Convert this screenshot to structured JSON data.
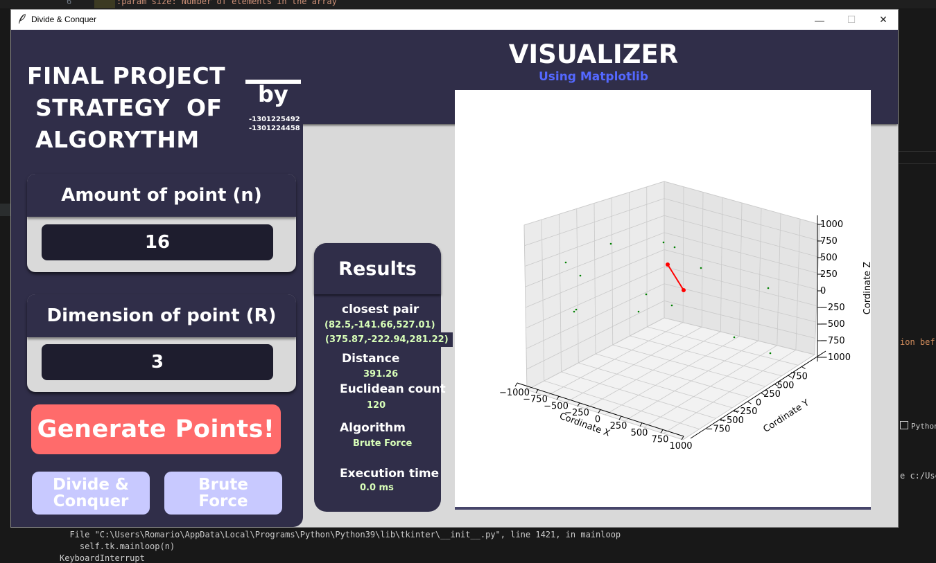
{
  "background": {
    "line_number": "6",
    "code_line": ":param size: Number of elements in the array",
    "right_texts": [
      "ion bef",
      "Python",
      "e c:/User"
    ],
    "terminal_lines": [
      "  File \"C:\\Users\\Romario\\AppData\\Local\\Programs\\Python\\Python39\\lib\\tkinter\\__init__.py\", line 1421, in mainloop",
      "    self.tk.mainloop(n)",
      "KeyboardInterrupt"
    ]
  },
  "window": {
    "title": "Divide & Conquer",
    "minimize": "—",
    "maximize": "☐",
    "close": "✕"
  },
  "left": {
    "title": "FINAL PROJECT\n STRATEGY  OF\n ALGORYTHM",
    "by": "by",
    "nims": "-1301225492\n-1301224458",
    "amount_label": "Amount of point (n)",
    "amount_value": "16",
    "dimension_label": "Dimension of point (R)",
    "dimension_value": "3",
    "generate_label": "Generate Points!",
    "divide_label": "Divide &\nConquer",
    "brute_label": "Brute\nForce"
  },
  "visualizer": {
    "title": "VISUALIZER",
    "subtitle": "Using Matplotlib"
  },
  "results": {
    "title": "Results",
    "closest_label": "closest pair",
    "point_a": "(82.5,-141.66,527.01)",
    "point_b": "(375.87,-222.94,281.22)",
    "distance_label": "Distance",
    "distance_value": "391.26",
    "euclid_label": "Euclidean count",
    "euclid_value": "120",
    "algorithm_label": "Algorithm",
    "algorithm_value": "Brute Force",
    "time_label": "Execution time",
    "time_value": "0.0 ms"
  },
  "colors": {
    "panel": "#302e49",
    "generate": "#ff6b6b",
    "alg_button": "#c8c9ff",
    "subtitle": "#5468ff",
    "point": "#008000",
    "pair": "#ff0000"
  },
  "chart_data": {
    "type": "scatter",
    "dimensions": 3,
    "xlabel": "Cordinate X",
    "ylabel": "Cordinate Y",
    "zlabel": "Cordinate Z",
    "xticks": [
      "−1000",
      "−750",
      "−500",
      "−250",
      "0",
      "250",
      "500",
      "750",
      "1000"
    ],
    "yticks": [
      "−750",
      "−500",
      "−250",
      "0",
      "250",
      "500",
      "750"
    ],
    "zticks": [
      "1000",
      "750",
      "500",
      "250",
      "0",
      "−250",
      "−500",
      "−750",
      "−1000"
    ],
    "xlim": [
      -1000,
      1000
    ],
    "ylim": [
      -1000,
      1000
    ],
    "zlim": [
      -1000,
      1000
    ],
    "grid": true,
    "closest_pair": [
      [
        82.5,
        -141.66,
        527.01
      ],
      [
        375.87,
        -222.94,
        281.22
      ]
    ],
    "point_count": 16
  }
}
